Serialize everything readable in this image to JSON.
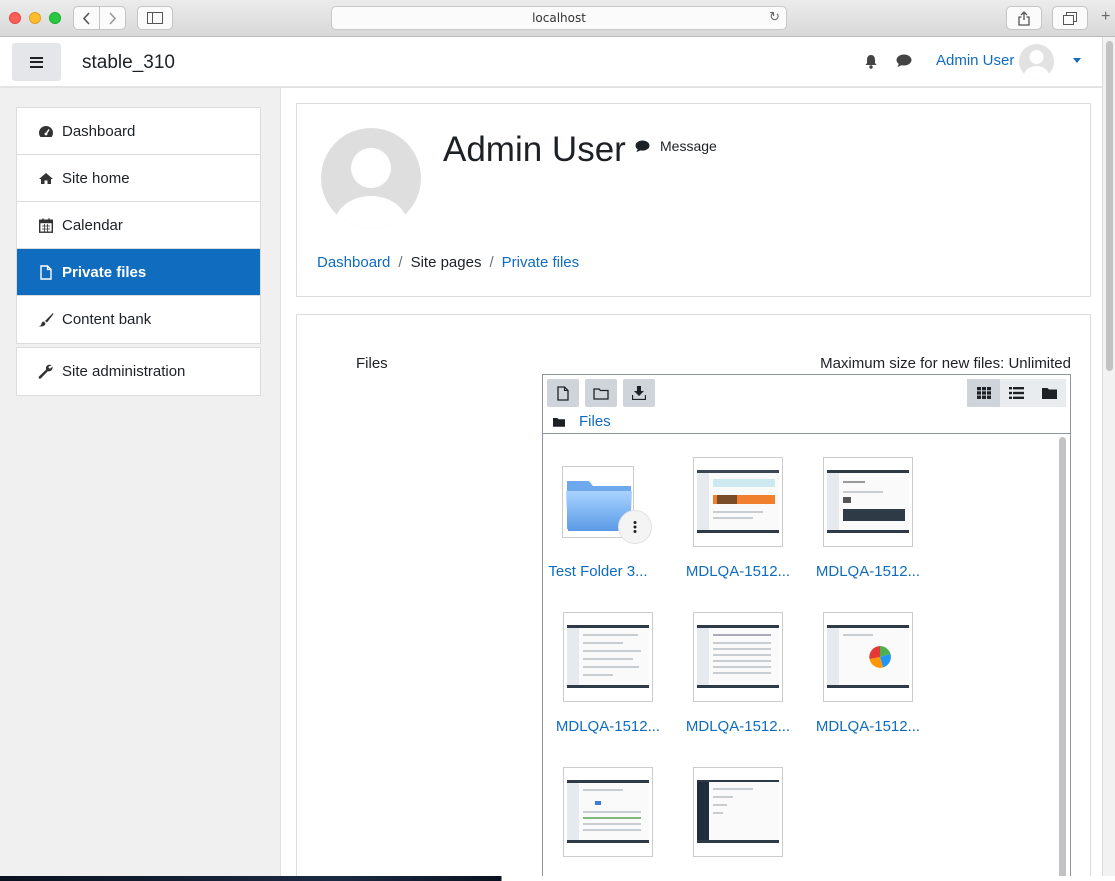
{
  "browser": {
    "url": "localhost"
  },
  "navbar": {
    "site_name": "stable_310",
    "user_name": "Admin User"
  },
  "sidebar": {
    "items": [
      {
        "label": "Dashboard",
        "icon": "dashboard-icon"
      },
      {
        "label": "Site home",
        "icon": "home-icon"
      },
      {
        "label": "Calendar",
        "icon": "calendar-icon"
      },
      {
        "label": "Private files",
        "icon": "file-icon",
        "active": true
      },
      {
        "label": "Content bank",
        "icon": "paintbrush-icon"
      }
    ],
    "admin": {
      "label": "Site administration",
      "icon": "wrench-icon"
    }
  },
  "profile": {
    "name": "Admin User",
    "message_label": "Message",
    "breadcrumb": [
      "Dashboard",
      "Site pages",
      "Private files"
    ]
  },
  "files": {
    "label": "Files",
    "max_size": "Maximum size for new files: Unlimited",
    "path_label": "Files",
    "tiles": [
      {
        "name": "Test Folder 3...",
        "type": "folder"
      },
      {
        "name": "MDLQA-1512...",
        "type": "image"
      },
      {
        "name": "MDLQA-1512...",
        "type": "image"
      },
      {
        "name": "MDLQA-1512...",
        "type": "image"
      },
      {
        "name": "MDLQA-1512...",
        "type": "image"
      },
      {
        "name": "MDLQA-1512...",
        "type": "image"
      },
      {
        "name": "",
        "type": "image"
      },
      {
        "name": "",
        "type": "image"
      }
    ]
  },
  "colors": {
    "primary": "#0f6cbf",
    "sidebar_bg": "#f0f0f0"
  }
}
